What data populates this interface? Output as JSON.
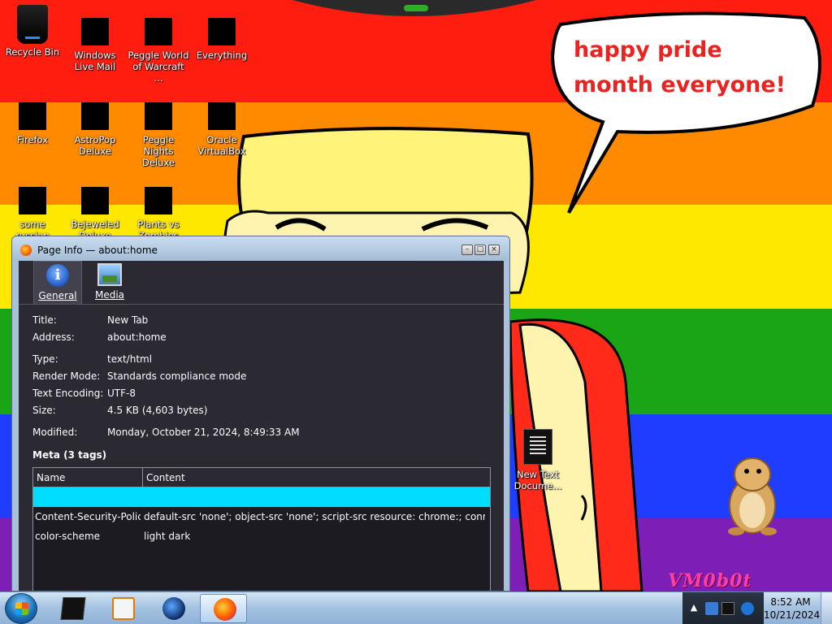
{
  "desktop": {
    "speech_text": "happy pride month everyone!",
    "watermark": "VM0b0t",
    "icons": [
      {
        "label": "Recycle Bin"
      },
      {
        "label": "Windows Live Mail"
      },
      {
        "label": "Peggle World of Warcraft ..."
      },
      {
        "label": "Everything"
      },
      {
        "label": "Firefox"
      },
      {
        "label": "AstroPop Deluxe"
      },
      {
        "label": "Peggle Nights Deluxe"
      },
      {
        "label": "Oracle VirtualBox"
      },
      {
        "label": "some russian crap.exe"
      },
      {
        "label": "Bejeweled Deluxe"
      },
      {
        "label": "Plants vs Zombies"
      },
      {
        "label": "New Text Docume..."
      }
    ]
  },
  "window": {
    "title": "Page Info — about:home",
    "tabs": [
      {
        "label": "General",
        "selected": true
      },
      {
        "label": "Media",
        "selected": false
      }
    ],
    "general": {
      "title_label": "Title:",
      "title_value": "New Tab",
      "address_label": "Address:",
      "address_value": "about:home",
      "type_label": "Type:",
      "type_value": "text/html",
      "render_label": "Render Mode:",
      "render_value": "Standards compliance mode",
      "encoding_label": "Text Encoding:",
      "encoding_value": "UTF-8",
      "size_label": "Size:",
      "size_value": "4.5 KB (4,603 bytes)",
      "modified_label": "Modified:",
      "modified_value": "Monday, October 21, 2024, 8:49:33 AM"
    },
    "meta": {
      "heading": "Meta (3 tags)",
      "columns": [
        "Name",
        "Content"
      ],
      "rows": [
        {
          "name": "",
          "content": ""
        },
        {
          "name": "Content-Security-Polic...",
          "content": "default-src 'none'; object-src 'none'; script-src resource: chrome:; connect-src ..."
        },
        {
          "name": "color-scheme",
          "content": "light dark"
        }
      ]
    }
  },
  "taskbar": {
    "clock_time": "8:52 AM",
    "clock_date": "10/21/2024"
  },
  "colors": {
    "dialog_bg": "#2b2a33",
    "selection": "#00ddff",
    "speech_text": "#e82320"
  }
}
